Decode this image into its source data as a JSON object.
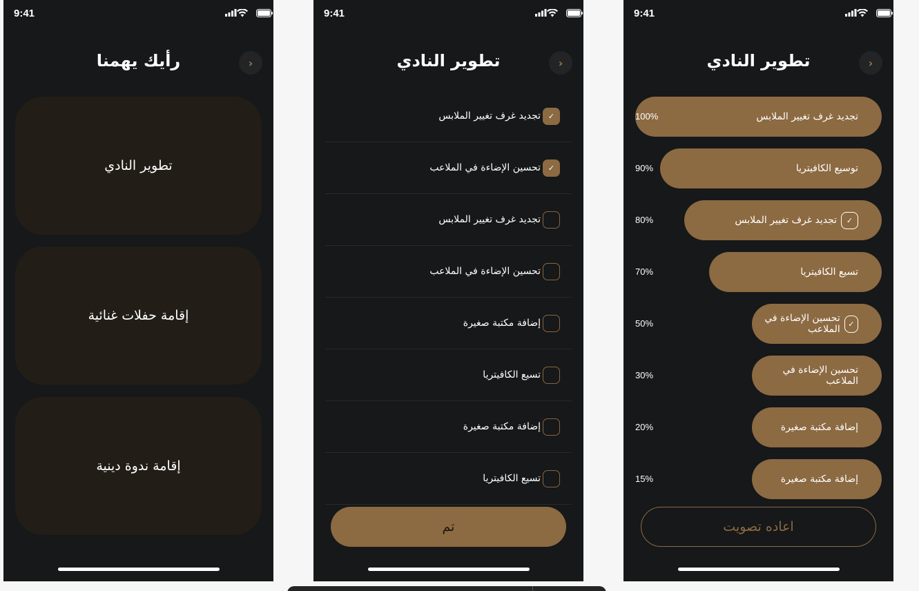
{
  "status_bar": {
    "time": "9:41"
  },
  "screen1": {
    "title": "رأيك يهمنا",
    "cards": [
      "تطوير النادي",
      "إقامة حفلات غنائية",
      "إقامة ندوة دينية"
    ]
  },
  "screen2": {
    "title": "تطوير النادي",
    "options": [
      {
        "label": "تجديد غرف تغيير الملابس",
        "checked": true
      },
      {
        "label": "تحسين الإضاءة في الملاعب",
        "checked": true
      },
      {
        "label": "تجديد غرف تغيير الملابس",
        "checked": false
      },
      {
        "label": "تحسين الإضاءة في الملاعب",
        "checked": false
      },
      {
        "label": "إضافة مكتبة صغيرة",
        "checked": false
      },
      {
        "label": "تسيع الكافيتريا",
        "checked": false
      },
      {
        "label": "إضافة مكتبة صغيرة",
        "checked": false
      },
      {
        "label": "تسيع الكافيتريا",
        "checked": false
      }
    ],
    "submit_label": "تم"
  },
  "screen3": {
    "title": "تطوير النادي",
    "results": [
      {
        "label": "تجديد غرف تغيير الملابس",
        "percent": "100%",
        "value": 1.0,
        "selected": false
      },
      {
        "label": "توسيع الكافيتريا",
        "percent": "90%",
        "value": 0.9,
        "selected": false
      },
      {
        "label": "تجديد غرف تغيير الملابس",
        "percent": "80%",
        "value": 0.8,
        "selected": true
      },
      {
        "label": "تسيع الكافيتريا",
        "percent": "70%",
        "value": 0.7,
        "selected": false
      },
      {
        "label": "تحسين الإضاءة في الملاعب",
        "percent": "50%",
        "value": 0.5,
        "selected": true
      },
      {
        "label": "تحسين الإضاءة في الملاعب",
        "percent": "30%",
        "value": 0.3,
        "selected": false
      },
      {
        "label": "إضافة مكتبة صغيرة",
        "percent": "20%",
        "value": 0.2,
        "selected": false
      },
      {
        "label": "إضافة مكتبة صغيرة",
        "percent": "15%",
        "value": 0.15,
        "selected": false
      }
    ],
    "revote_label": "اعاده تصويت"
  },
  "colors": {
    "background": "#16181a",
    "accent": "#8c6a42",
    "card": "#221d17",
    "text": "#ffffff"
  },
  "icons": {
    "back": "chevron-right-icon",
    "check": "checkmark-icon",
    "signal": "signal-icon",
    "wifi": "wifi-icon",
    "battery": "battery-icon"
  }
}
